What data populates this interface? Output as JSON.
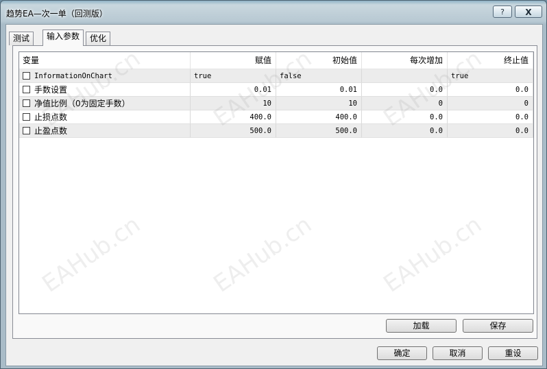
{
  "window": {
    "title": "趋势EA—次一单（回测版）",
    "help_label": "?",
    "close_label": "X"
  },
  "tabs": [
    {
      "label": "测试",
      "active": false
    },
    {
      "label": "输入参数",
      "active": true
    },
    {
      "label": "优化",
      "active": false
    }
  ],
  "grid": {
    "columns": [
      "变量",
      "赋值",
      "初始值",
      "每次增加",
      "终止值"
    ],
    "rows": [
      {
        "name": "InformationOnChart",
        "value": "true",
        "start": "false",
        "step": "",
        "stop": "true",
        "checked": false
      },
      {
        "name": "手数设置",
        "value": "0.01",
        "start": "0.01",
        "step": "0.0",
        "stop": "0.0",
        "checked": false
      },
      {
        "name": "净值比例（0为固定手数）",
        "value": "10",
        "start": "10",
        "step": "0",
        "stop": "0",
        "checked": false
      },
      {
        "name": "止损点数",
        "value": "400.0",
        "start": "400.0",
        "step": "0.0",
        "stop": "0.0",
        "checked": false
      },
      {
        "name": "止盈点数",
        "value": "500.0",
        "start": "500.0",
        "step": "0.0",
        "stop": "0.0",
        "checked": false
      }
    ]
  },
  "panel_buttons": {
    "load": "加载",
    "save": "保存"
  },
  "dialog_buttons": {
    "ok": "确定",
    "cancel": "取消",
    "reset": "重设"
  },
  "watermark": "EAHub.cn"
}
